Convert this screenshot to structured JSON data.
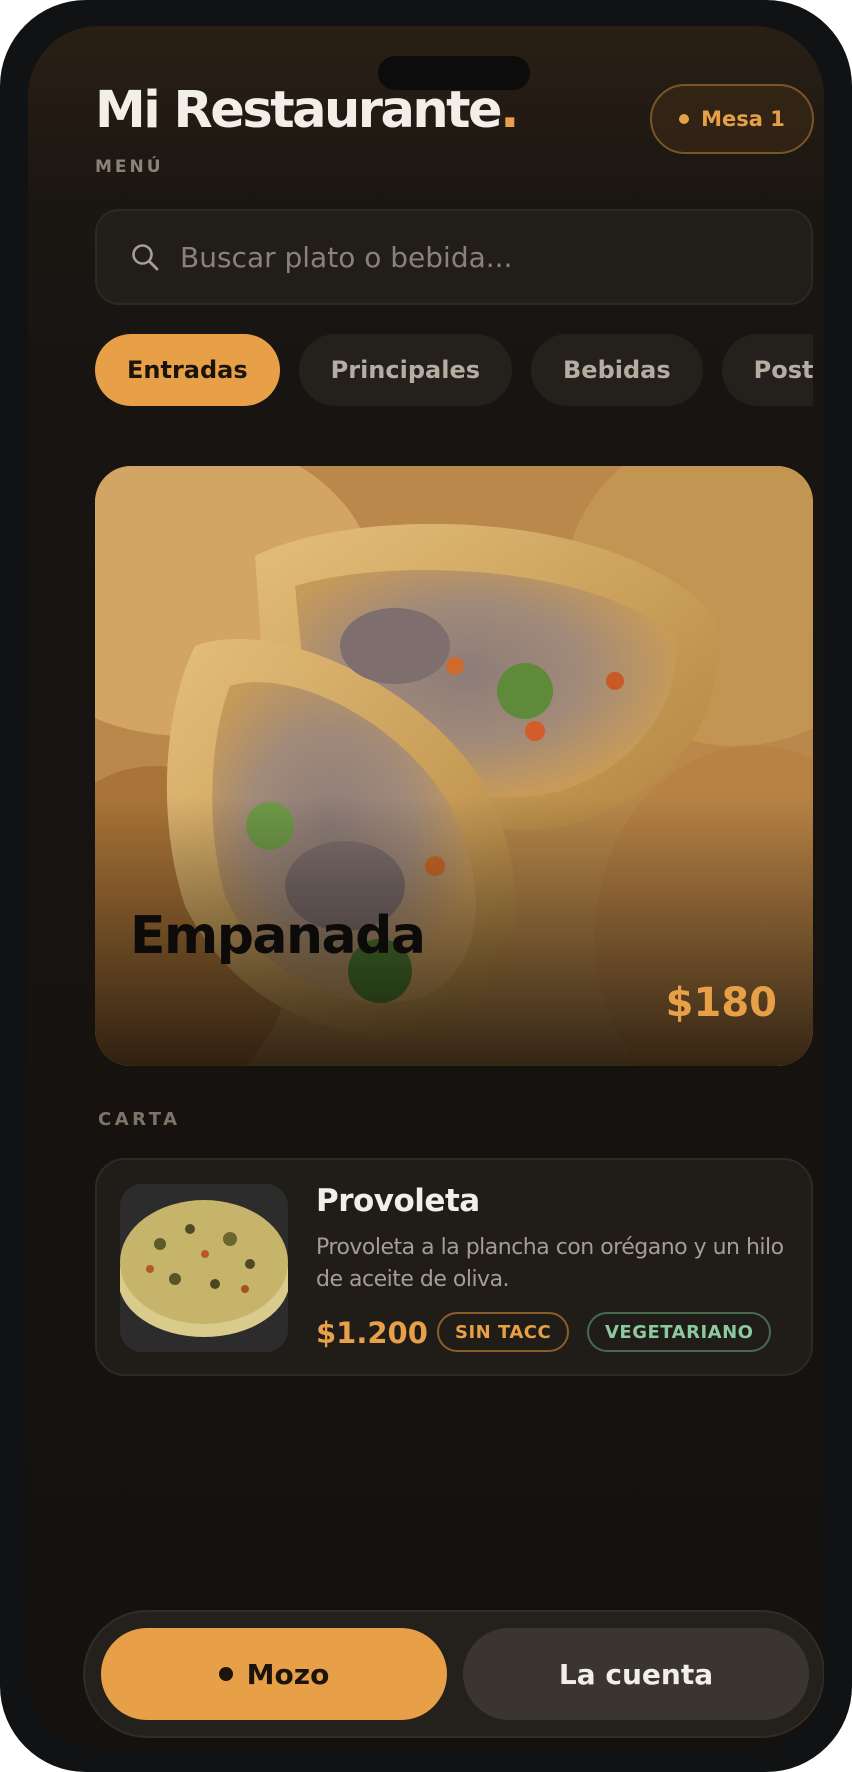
{
  "header": {
    "title": "Mi Restaurante",
    "title_dot": ".",
    "subtitle": "MENÚ",
    "table_label": "Mesa 1"
  },
  "search": {
    "placeholder": "Buscar plato o bebida..."
  },
  "categories": [
    {
      "label": "Entradas",
      "active": true
    },
    {
      "label": "Principales",
      "active": false
    },
    {
      "label": "Bebidas",
      "active": false
    },
    {
      "label": "Postres",
      "active": false
    }
  ],
  "featured": {
    "name": "Empanada",
    "price": "$180"
  },
  "section": {
    "label": "CARTA"
  },
  "items": [
    {
      "name": "Provoleta",
      "description": "Provoleta a la plancha con orégano y un hilo de aceite de oliva.",
      "price": "$1.200",
      "badges": [
        "SIN TACC",
        "VEGETARIANO"
      ]
    }
  ],
  "actions": {
    "waiter": "Mozo",
    "bill": "La cuenta"
  },
  "colors": {
    "accent": "#e7a048",
    "background": "#14110e",
    "vegetarian": "#8dc99e"
  }
}
